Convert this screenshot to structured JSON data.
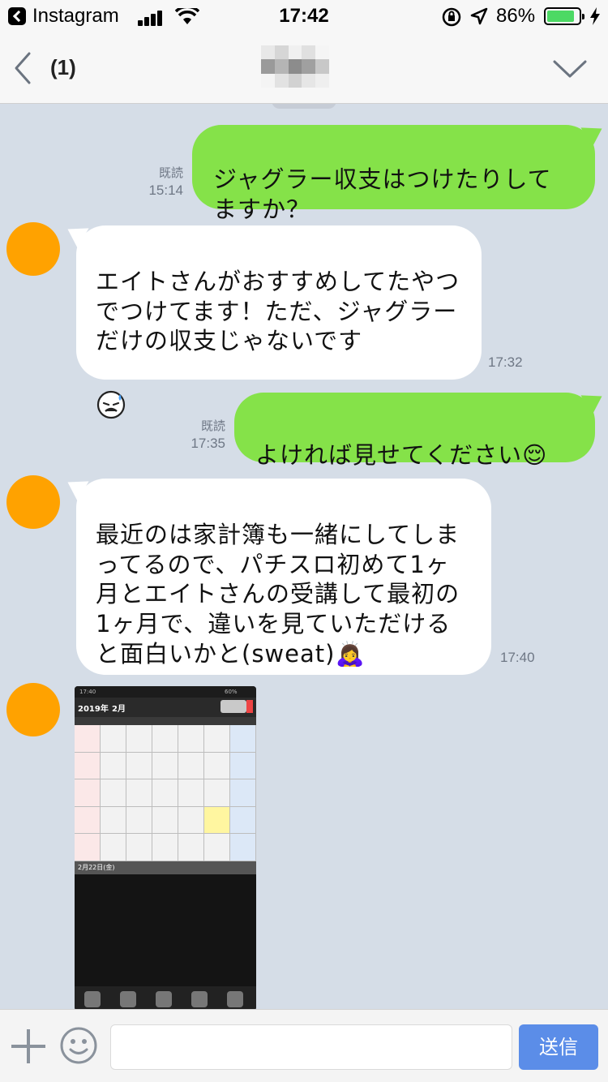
{
  "status_bar": {
    "back_app": "Instagram",
    "time": "17:42",
    "battery_percent_label": "86%",
    "battery_level": 0.86
  },
  "header": {
    "back_label": "(1)"
  },
  "messages": [
    {
      "direction": "outgoing",
      "text": "ジャグラー収支はつけたりしてますか？",
      "read_label": "既読",
      "time": "15:14"
    },
    {
      "direction": "incoming",
      "text": "エイトさんがおすすめしてたやつでつけてます！ただ、ジャグラーだけの収支じゃないです",
      "emoji": "sad-sweat-face-icon",
      "time": "17:32"
    },
    {
      "direction": "outgoing",
      "text": "よければ見せてください😌",
      "read_label": "既読",
      "time": "17:35"
    },
    {
      "direction": "incoming",
      "text": "最近のは家計簿も一緒にしてしまってるので、パチスロ初めて1ヶ月とエイトさんの受講して最初の1ヶ月で、違いを見ていただけると面白いかと(sweat)🙇‍♀️",
      "time": "17:40"
    },
    {
      "direction": "incoming",
      "type": "image",
      "image": {
        "status_time": "17:40",
        "battery": "60%",
        "year": "2019年",
        "month": "2月",
        "selected_date": "2月22日(金)"
      }
    }
  ],
  "input_bar": {
    "placeholder": "",
    "send_label": "送信"
  },
  "colors": {
    "background": "#d5dde7",
    "outgoing_bubble": "#85e249",
    "incoming_bubble": "#ffffff",
    "avatar": "#ffa200",
    "send_button": "#5b8de8",
    "battery_fill": "#4cd964"
  }
}
